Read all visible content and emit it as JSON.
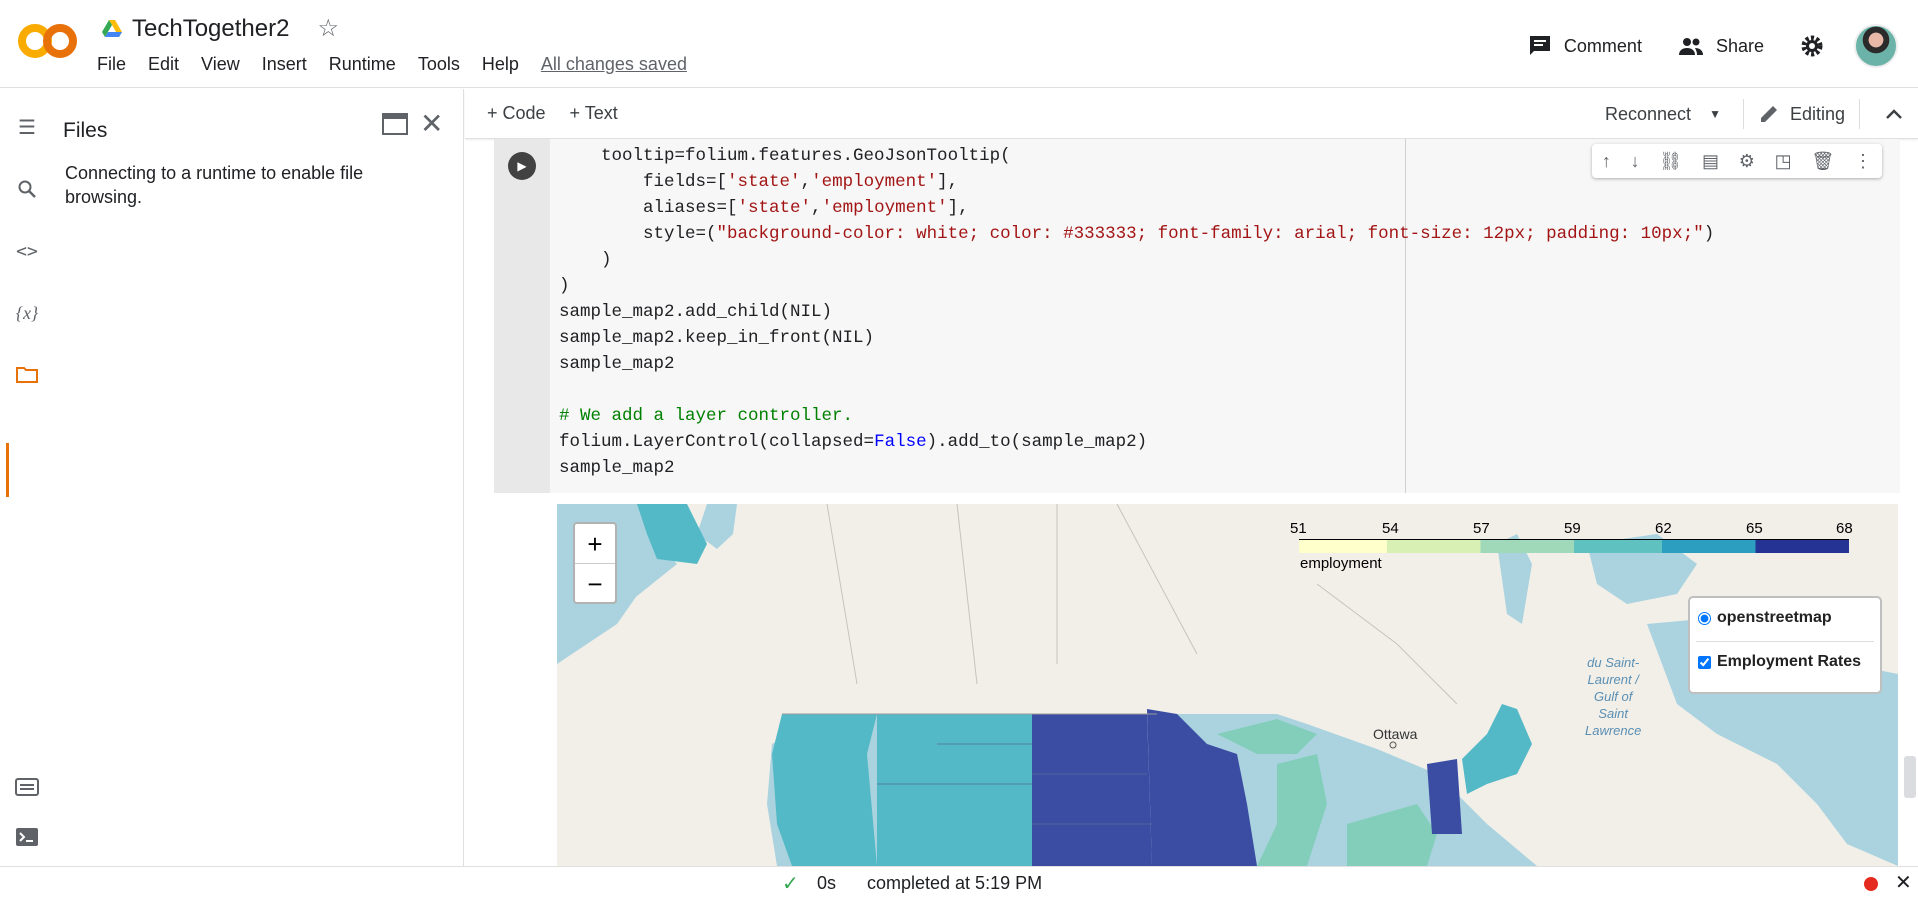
{
  "app": {
    "title": "TechTogether2",
    "logo_text": "CO"
  },
  "menu": [
    "File",
    "Edit",
    "View",
    "Insert",
    "Runtime",
    "Tools",
    "Help"
  ],
  "save_status": "All changes saved",
  "header_actions": {
    "comment": "Comment",
    "share": "Share"
  },
  "files_panel": {
    "title": "Files",
    "message": "Connecting to a runtime to enable file browsing."
  },
  "toolbar": {
    "add_code": "+ Code",
    "add_text": "+ Text",
    "reconnect": "Reconnect",
    "editing": "Editing"
  },
  "code_lines": [
    "    tooltip=folium.features.GeoJsonTooltip(",
    "        fields=['state','employment'],",
    "        aliases=['state','employment'],",
    "        style=(\"background-color: white; color: #333333; font-family: arial; font-size: 12px; padding: 10px;\")",
    "    )",
    ")",
    "sample_map2.add_child(NIL)",
    "sample_map2.keep_in_front(NIL)",
    "sample_map2",
    "",
    "# We add a layer controller.",
    "folium.LayerControl(collapsed=False).add_to(sample_map2)",
    "sample_map2"
  ],
  "map": {
    "zoom_in": "+",
    "zoom_out": "−",
    "legend_ticks": [
      "51",
      "54",
      "57",
      "59",
      "62",
      "65",
      "68"
    ],
    "legend_label": "employment",
    "layers": {
      "base": "openstreetmap",
      "overlay": "Employment Rates"
    },
    "places": {
      "ottawa": "Ottawa",
      "gulf": "du Saint-\nLaurent /\nGulf of\nSaint\nLawrence"
    }
  },
  "status": {
    "duration": "0s",
    "completed": "completed at 5:19 PM"
  },
  "colors": {
    "accent": "#e8710a",
    "map_water": "#aad3df",
    "map_land": "#f2efe9",
    "choropleth_low": "#ffffcc",
    "choropleth_high": "#253494"
  }
}
